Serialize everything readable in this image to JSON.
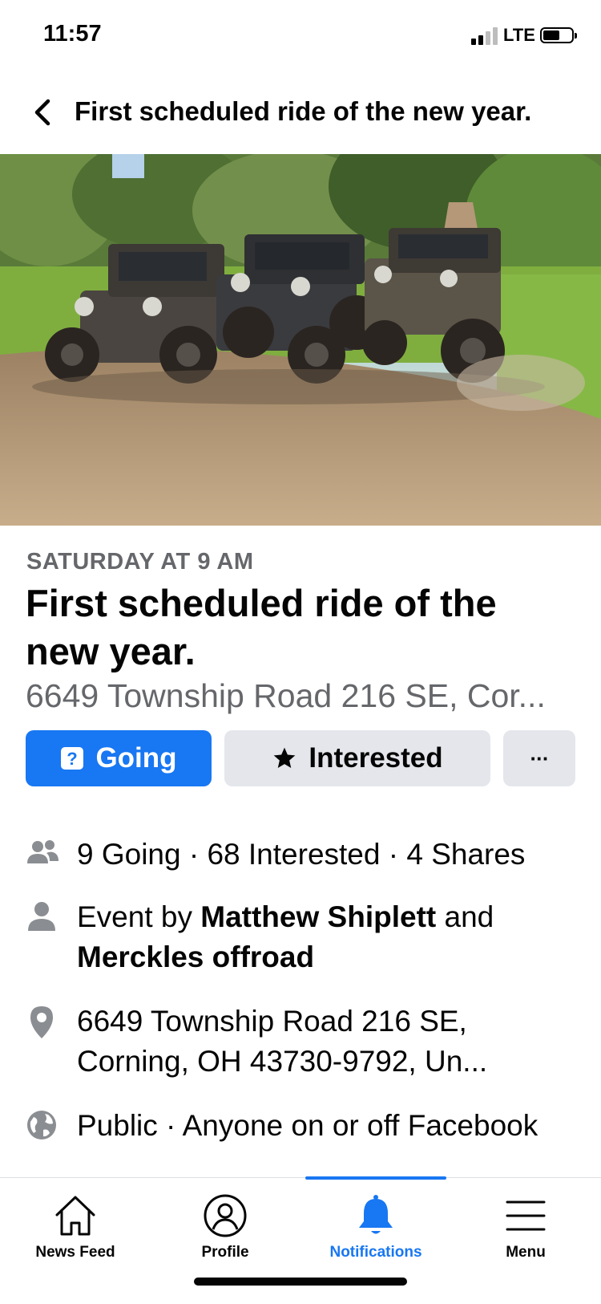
{
  "status_bar": {
    "time": "11:57",
    "network": "LTE"
  },
  "header": {
    "title": "First scheduled ride of the new year."
  },
  "event": {
    "date": "SATURDAY AT 9 AM",
    "title": "First scheduled ride of the new year.",
    "address_short": "6649 Township Road 216 SE, Cor..."
  },
  "actions": {
    "going": "Going",
    "interested": "Interested",
    "more": "···"
  },
  "details": {
    "stats": "9 Going · 68 Interested · 4 Shares",
    "host_prefix": "Event by ",
    "host_1": "Matthew Shiplett",
    "host_and": " and ",
    "host_2": "Merckles offroad",
    "location": "6649 Township Road 216 SE, Corning, OH 43730-9792, Un...",
    "privacy": "Public · Anyone on or off Facebook"
  },
  "tabs": [
    {
      "label": "News Feed",
      "icon": "home-icon"
    },
    {
      "label": "Profile",
      "icon": "profile-icon"
    },
    {
      "label": "Notifications",
      "icon": "bell-icon",
      "active": true
    },
    {
      "label": "Menu",
      "icon": "menu-icon"
    }
  ],
  "colors": {
    "accent": "#1877f2",
    "secondary_text": "#65676b",
    "button_gray": "#e4e6eb"
  }
}
